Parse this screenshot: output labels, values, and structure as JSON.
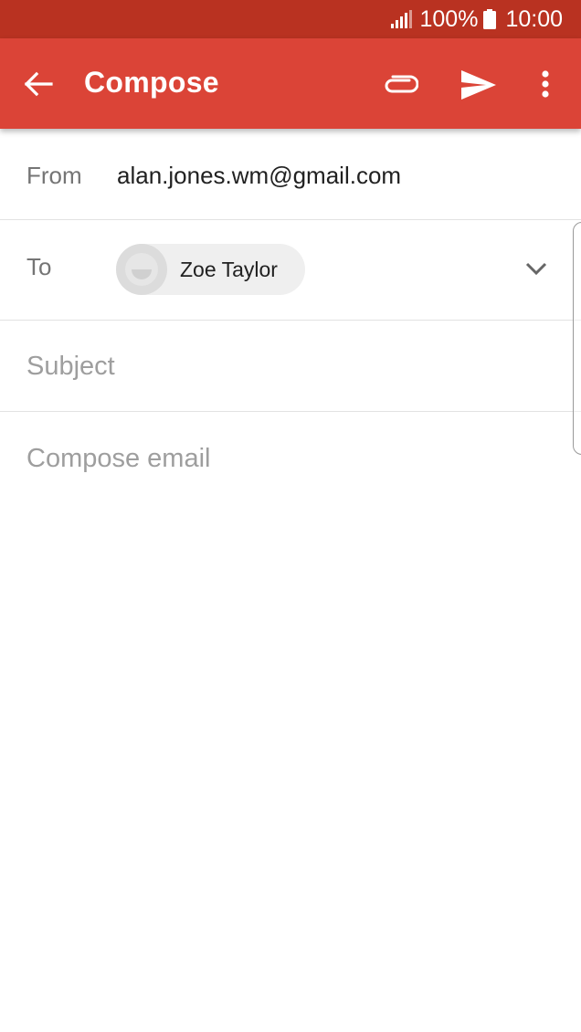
{
  "status_bar": {
    "battery_percent": "100%",
    "time": "10:00"
  },
  "app_bar": {
    "title": "Compose",
    "icons": {
      "back": "arrow-left-icon",
      "attach": "paperclip-icon",
      "send": "send-icon",
      "more": "more-vert-icon"
    }
  },
  "from": {
    "label": "From",
    "value": "alan.jones.wm@gmail.com"
  },
  "to": {
    "label": "To",
    "recipients": [
      {
        "name": "Zoe Taylor"
      }
    ]
  },
  "subject": {
    "placeholder": "Subject"
  },
  "body": {
    "placeholder": "Compose email"
  },
  "colors": {
    "status_bar": "#b93221",
    "app_bar": "#db4437",
    "chip_bg": "#efefef"
  }
}
